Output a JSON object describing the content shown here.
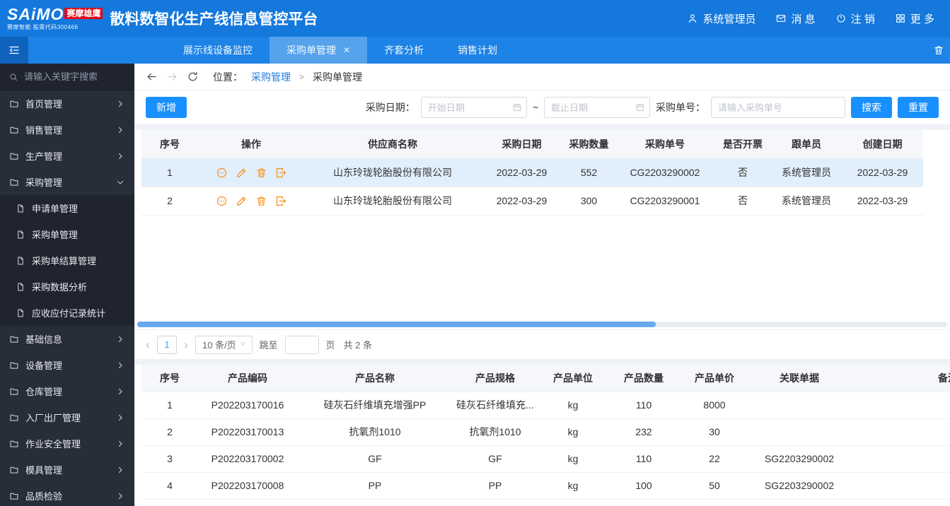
{
  "colors": {
    "primary": "#1890ff",
    "topbar": "#1478dc",
    "sidebar": "#282d3a",
    "logo_red": "#e60012",
    "icon_orange": "#fa8c16",
    "selected_row": "#e1effd"
  },
  "topbar": {
    "logo_main": "SAiMO",
    "logo_overlay": "赛摩雄鹰",
    "logo_sub": "赛摩智能 股票代码300466",
    "title": "散料数智化生产线信息管控平台",
    "user": "系统管理员",
    "messages": "消 息",
    "logout": "注 销",
    "more": "更 多"
  },
  "tabs": [
    {
      "label": "展示线设备监控",
      "active": false,
      "closable": false
    },
    {
      "label": "采购单管理",
      "active": true,
      "closable": true
    },
    {
      "label": "齐套分析",
      "active": false,
      "closable": false
    },
    {
      "label": "销售计划",
      "active": false,
      "closable": false
    }
  ],
  "sidebar": {
    "search_placeholder": "请输入关键字搜索",
    "menu": [
      {
        "label": "首页管理",
        "expanded": false
      },
      {
        "label": "销售管理",
        "expanded": false
      },
      {
        "label": "生产管理",
        "expanded": false
      },
      {
        "label": "采购管理",
        "expanded": true,
        "children": [
          "申请单管理",
          "采购单管理",
          "采购单结算管理",
          "采购数据分析",
          "应收应付记录统计"
        ]
      },
      {
        "label": "基础信息",
        "expanded": false
      },
      {
        "label": "设备管理",
        "expanded": false
      },
      {
        "label": "仓库管理",
        "expanded": false
      },
      {
        "label": "入厂出厂管理",
        "expanded": false
      },
      {
        "label": "作业安全管理",
        "expanded": false
      },
      {
        "label": "模具管理",
        "expanded": false
      },
      {
        "label": "品质检验",
        "expanded": false
      }
    ]
  },
  "breadcrumb": {
    "location_label": "位置：",
    "parent": "采购管理",
    "separator": ">",
    "current": "采购单管理"
  },
  "toolbar": {
    "add_label": "新增",
    "date_label": "采购日期：",
    "start_placeholder": "开始日期",
    "tilde": "~",
    "end_placeholder": "截止日期",
    "order_label": "采购单号：",
    "order_placeholder": "请输入采购单号",
    "search_label": "搜索",
    "reset_label": "重置"
  },
  "orders_table": {
    "headers": [
      "序号",
      "操作",
      "供应商名称",
      "采购日期",
      "采购数量",
      "采购单号",
      "是否开票",
      "跟单员",
      "创建日期"
    ],
    "rows": [
      {
        "index": "1",
        "supplier": "山东玲珑轮胎股份有限公司",
        "date": "2022-03-29",
        "qty": "552",
        "order_no": "CG2203290002",
        "invoiced": "否",
        "follower": "系统管理员",
        "created": "2022-03-29",
        "selected": true
      },
      {
        "index": "2",
        "supplier": "山东玲珑轮胎股份有限公司",
        "date": "2022-03-29",
        "qty": "300",
        "order_no": "CG2203290001",
        "invoiced": "否",
        "follower": "系统管理员",
        "created": "2022-03-29",
        "selected": false
      }
    ]
  },
  "pagination": {
    "prev": "‹",
    "page": "1",
    "next": "›",
    "page_size": "10 条/页",
    "jump_label": "跳至",
    "jump_value": "",
    "jump_suffix": "页",
    "total": "共 2 条"
  },
  "products_table": {
    "headers": [
      "序号",
      "产品编码",
      "产品名称",
      "产品规格",
      "产品单位",
      "产品数量",
      "产品单价",
      "关联单据",
      "备注"
    ],
    "rows": [
      [
        "1",
        "P202203170016",
        "硅灰石纤维填充增强PP",
        "硅灰石纤维填充...",
        "kg",
        "110",
        "8000",
        "",
        ""
      ],
      [
        "2",
        "P202203170013",
        "抗氧剂1010",
        "抗氧剂1010",
        "kg",
        "232",
        "30",
        "",
        ""
      ],
      [
        "3",
        "P202203170002",
        "GF",
        "GF",
        "kg",
        "110",
        "22",
        "SG2203290002",
        ""
      ],
      [
        "4",
        "P202203170008",
        "PP",
        "PP",
        "kg",
        "100",
        "50",
        "SG2203290002",
        ""
      ]
    ]
  },
  "icons": {
    "user": "user-icon",
    "mail": "mail-icon",
    "power": "logout-icon",
    "grid": "more-grid-icon",
    "collapse": "menu-fold-icon",
    "trash": "trash-icon",
    "search": "search-icon",
    "folder": "folder-icon",
    "doc": "document-icon",
    "back": "back-arrow-icon",
    "forward": "forward-arrow-icon",
    "refresh": "refresh-icon",
    "calendar": "calendar-icon",
    "ops": [
      "detail-icon",
      "edit-icon",
      "delete-icon",
      "export-icon"
    ]
  }
}
